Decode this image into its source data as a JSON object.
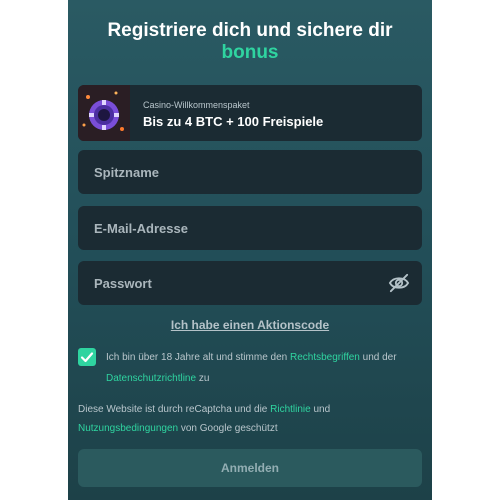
{
  "header": {
    "title_line1": "Registriere dich und sichere dir",
    "title_accent": "bonus"
  },
  "promo": {
    "subtitle": "Casino-Willkommenspaket",
    "offer": "Bis zu 4 BTC + 100 Freispiele"
  },
  "form": {
    "nickname_placeholder": "Spitzname",
    "email_placeholder": "E-Mail-Adresse",
    "password_placeholder": "Passwort",
    "promo_code_link": "Ich habe einen Aktionscode",
    "terms": {
      "checked": true,
      "part1": "Ich bin über 18 Jahre alt und stimme den ",
      "link1": "Rechtsbegriffen",
      "part2": " und der ",
      "link2": "Datenschutzrichtline",
      "part3": " zu"
    },
    "recaptcha": {
      "part1": "Diese Website ist durch reCaptcha und die ",
      "link1": "Richtlinie",
      "part2": " und ",
      "link2": "Nutzungsbedingungen",
      "part3": " von Google geschützt"
    },
    "submit_label": "Anmelden"
  },
  "colors": {
    "accent": "#2fd4a0",
    "panel_bg": "#23505a",
    "field_bg": "#1b2b33"
  },
  "icons": {
    "promo": "casino-chip-icon",
    "password_toggle": "eye-off-icon",
    "checkbox": "checkmark-icon"
  }
}
